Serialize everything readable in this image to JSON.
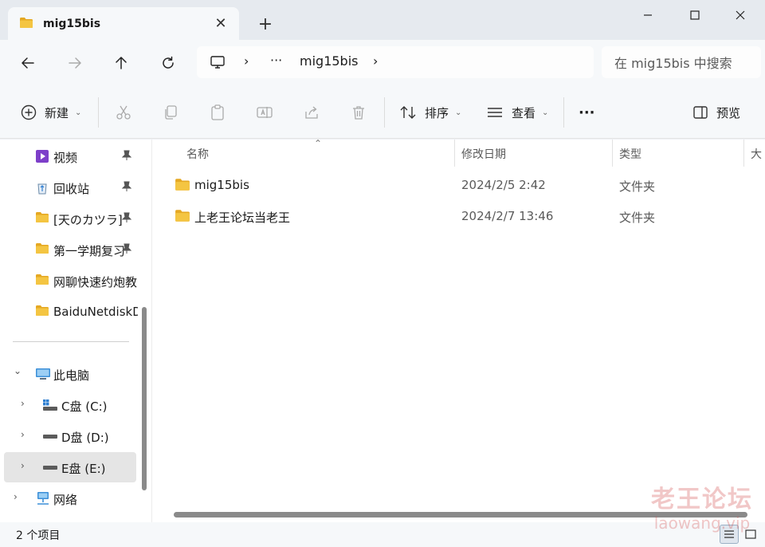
{
  "tab": {
    "title": "mig15bis",
    "close_glyph": "✕",
    "new_glyph": "+"
  },
  "address": {
    "more": "···",
    "current": "mig15bis",
    "sep": "›"
  },
  "search": {
    "placeholder": "在 mig15bis 中搜索"
  },
  "commands": {
    "new_label": "新建",
    "sort_label": "排序",
    "view_label": "查看",
    "more_label": "···",
    "preview_label": "预览"
  },
  "sidebar": {
    "quick_access": [
      {
        "label": "视频",
        "icon": "video-folder-icon",
        "pinned": true
      },
      {
        "label": "回收站",
        "icon": "recycle-bin-icon",
        "pinned": true
      },
      {
        "label": "[天のカツラ]",
        "icon": "folder-icon",
        "pinned": true
      },
      {
        "label": "第一学期复习",
        "icon": "folder-icon",
        "pinned": true
      },
      {
        "label": "网聊快速约炮教",
        "icon": "folder-icon",
        "pinned": false
      },
      {
        "label": "BaiduNetdiskD",
        "icon": "folder-icon",
        "pinned": false
      }
    ],
    "this_pc": "此电脑",
    "drives": [
      {
        "label": "C盘 (C:)"
      },
      {
        "label": "D盘 (D:)"
      },
      {
        "label": "E盘 (E:)"
      }
    ],
    "network": "网络",
    "expand_glyph": "›",
    "collapse_glyph": "⌄",
    "pin_glyph": "📌"
  },
  "columns": {
    "name": "名称",
    "date": "修改日期",
    "type": "类型",
    "size": "大"
  },
  "files": [
    {
      "name": "mig15bis",
      "date": "2024/2/5 2:42",
      "type": "文件夹"
    },
    {
      "name": "上老王论坛当老王",
      "date": "2024/2/7 13:46",
      "type": "文件夹"
    }
  ],
  "status": {
    "count": "2 个项目"
  },
  "watermark": {
    "main": "老王论坛",
    "sub": "laowang.vip"
  },
  "colors": {
    "folder": "#f4c542",
    "folder_dark": "#e5a823",
    "accent": "#0067c0"
  }
}
